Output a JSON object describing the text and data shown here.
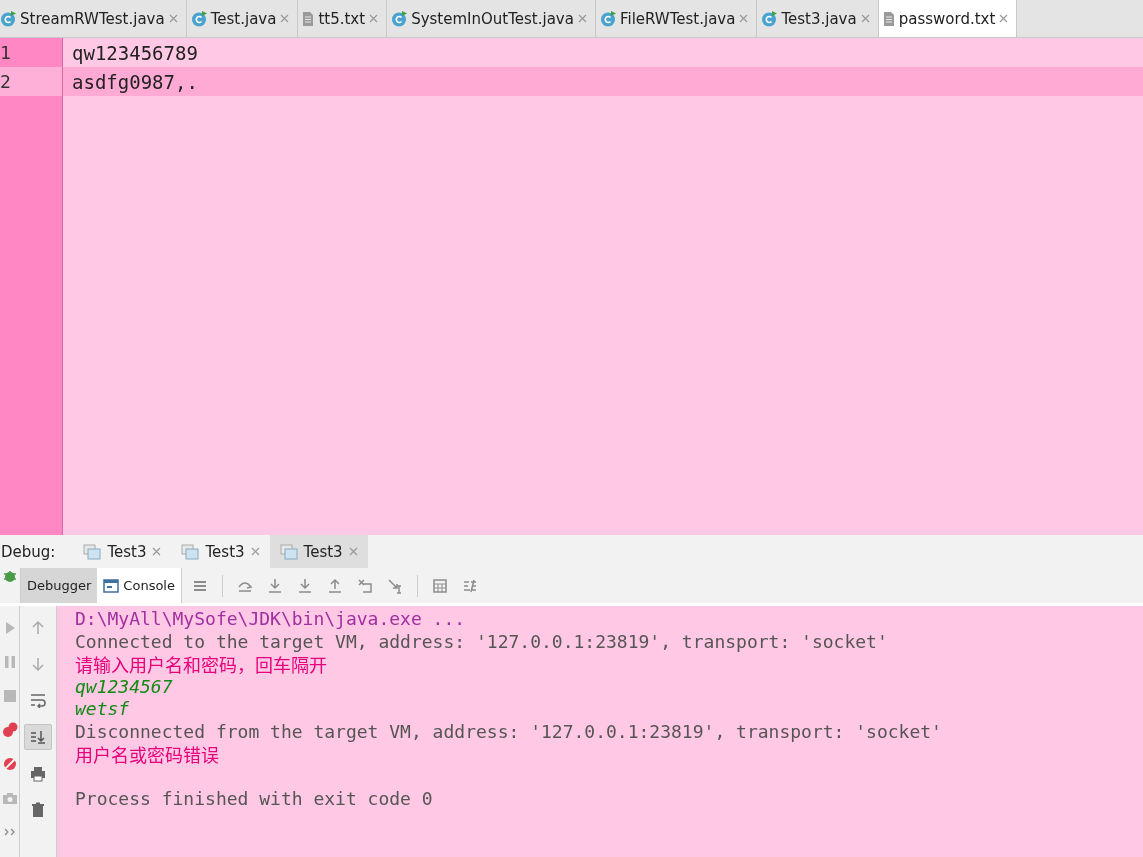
{
  "editor_tabs": [
    {
      "label": "StreamRWTest.java",
      "kind": "java",
      "selected": false
    },
    {
      "label": "Test.java",
      "kind": "java",
      "selected": false
    },
    {
      "label": "tt5.txt",
      "kind": "text",
      "selected": false
    },
    {
      "label": "SystemInOutTest.java",
      "kind": "java",
      "selected": false
    },
    {
      "label": "FileRWTest.java",
      "kind": "java",
      "selected": false
    },
    {
      "label": "Test3.java",
      "kind": "java",
      "selected": false
    },
    {
      "label": "password.txt",
      "kind": "text",
      "selected": true
    }
  ],
  "editor_lines": [
    {
      "number": "1",
      "text": "qw123456789",
      "current": false
    },
    {
      "number": "2",
      "text": "asdfg0987,.",
      "current": true
    }
  ],
  "debug": {
    "label": "Debug:",
    "sessions": [
      {
        "label": "Test3",
        "selected": false
      },
      {
        "label": "Test3",
        "selected": false
      },
      {
        "label": "Test3",
        "selected": true
      }
    ]
  },
  "panel_tabs": [
    {
      "label": "Debugger",
      "selected": false
    },
    {
      "label": "Console",
      "selected": true
    }
  ],
  "scroll_to_end_on": true,
  "console_lines": [
    {
      "kind": "system",
      "text": "D:\\MyAll\\MySofe\\JDK\\bin\\java.exe ..."
    },
    {
      "kind": "normal",
      "text": "Connected to the target VM, address: '127.0.0.1:23819', transport: 'socket'"
    },
    {
      "kind": "output",
      "text": "请输入用户名和密码，回车隔开"
    },
    {
      "kind": "input",
      "text": "qw1234567"
    },
    {
      "kind": "input",
      "text": "wetsf"
    },
    {
      "kind": "normal",
      "text": "Disconnected from the target VM, address: '127.0.0.1:23819', transport: 'socket'"
    },
    {
      "kind": "output",
      "text": "用户名或密码错误"
    },
    {
      "kind": "normal",
      "text": "Process finished with exit code 0",
      "gap_before": true
    }
  ]
}
